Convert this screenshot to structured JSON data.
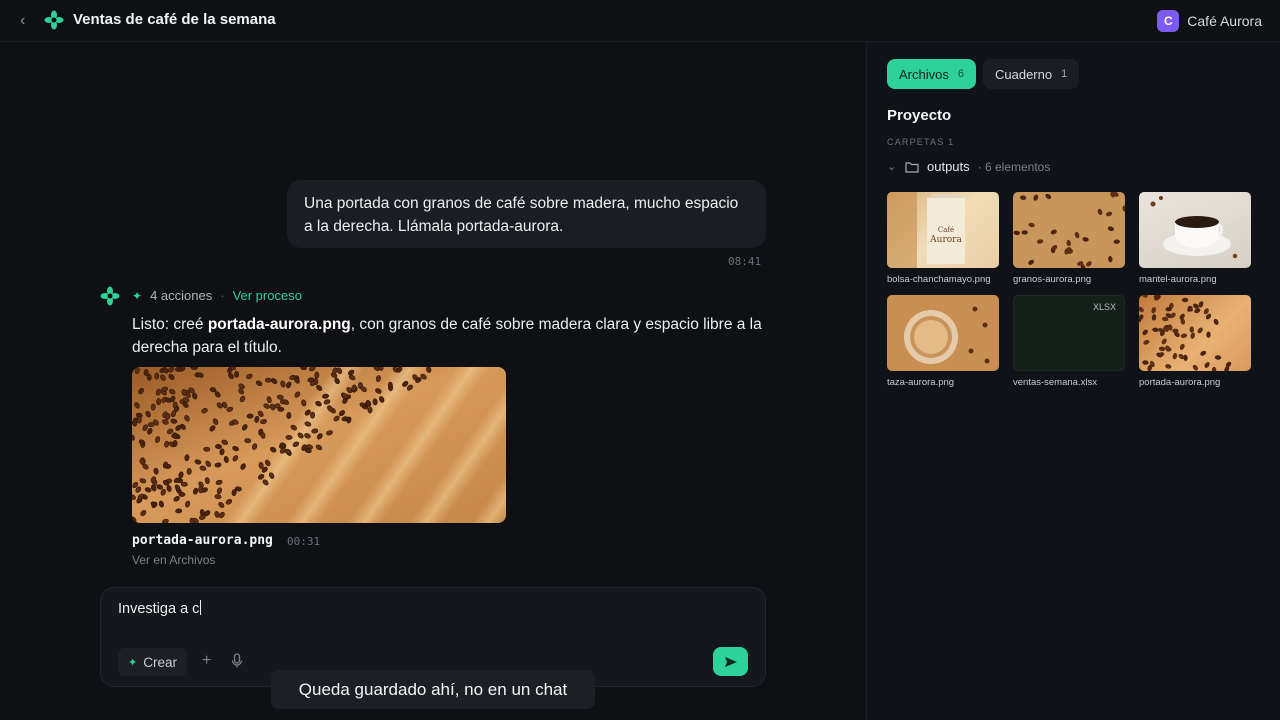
{
  "header": {
    "back_label": "‹",
    "title": "Ventas de café de la semana",
    "org_initial": "C",
    "org_name": "Café Aurora"
  },
  "panel": {
    "tabs": [
      {
        "label": "Archivos",
        "count": "6",
        "active": true
      },
      {
        "label": "Cuaderno",
        "count": "1",
        "active": false
      }
    ],
    "section_title": "Proyecto",
    "folders_label": "CARPETAS 1",
    "folder": {
      "name": "outputs",
      "meta": "· 6 elementos"
    },
    "files": [
      {
        "name": "bolsa-chanchamayo.png",
        "thumb": "bag"
      },
      {
        "name": "granos-aurora.png",
        "thumb": "beans"
      },
      {
        "name": "mantel-aurora.png",
        "thumb": "cup"
      },
      {
        "name": "taza-aurora.png",
        "thumb": "latte"
      },
      {
        "name": "ventas-semana.xlsx",
        "thumb": "xlsx",
        "tag": "XLSX"
      },
      {
        "name": "portada-aurora.png",
        "thumb": "portada"
      }
    ],
    "bag_brand": "Café",
    "bag_name": "Aurora"
  },
  "chat": {
    "user_message": "Una portada con granos de café sobre madera, mucho espacio a la derecha. Llámala portada-aurora.",
    "user_time": "08:41",
    "actions_label": "4 acciones",
    "actions_link": "Ver proceso",
    "bot_text_before": "Listo: creé ",
    "bot_text_bold": "portada-aurora.png",
    "bot_text_after": ", con granos de café sobre madera clara y espacio libre a la derecha para el título.",
    "image_name": "portada-aurora.png",
    "image_time": "00:31",
    "image_link": "Ver en Archivos"
  },
  "composer": {
    "value": "Investiga a c",
    "crear_label": "Crear"
  },
  "toast": "Queda guardado ahí, no en un chat",
  "colors": {
    "accent": "#2ed199",
    "org_badge": "#7c5cf0"
  }
}
